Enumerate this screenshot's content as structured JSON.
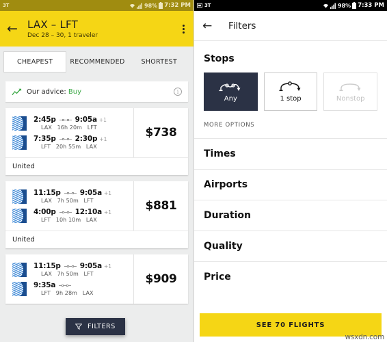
{
  "left": {
    "statusbar": {
      "temp": "3T",
      "wifi": "wifi-icon",
      "signal": "signal-icon",
      "battery_pct": "98%",
      "battery": "battery-icon",
      "time": "7:32 PM"
    },
    "appbar": {
      "back": "←",
      "title": "LAX – LFT",
      "subtitle": "Dec 28 – 30, 1 traveler",
      "menu": "overflow-menu-icon"
    },
    "tabs": [
      {
        "label": "CHEAPEST",
        "active": true
      },
      {
        "label": "RECOMMENDED",
        "active": false
      },
      {
        "label": "SHORTEST",
        "active": false
      }
    ],
    "advice": {
      "icon": "trending-up-icon",
      "text": "Our advice:",
      "value": "Buy",
      "info": "i"
    },
    "cards": [
      {
        "price": "$738",
        "airline": "United",
        "legs": [
          {
            "depart": "2:45p",
            "arrive": "9:05a",
            "plus": "+1",
            "from": "LAX",
            "duration": "16h 20m",
            "to": "LFT",
            "stops": 2
          },
          {
            "depart": "7:35p",
            "arrive": "2:30p",
            "plus": "+1",
            "from": "LFT",
            "duration": "20h 55m",
            "to": "LAX",
            "stops": 2
          }
        ]
      },
      {
        "price": "$881",
        "airline": "United",
        "legs": [
          {
            "depart": "11:15p",
            "arrive": "9:05a",
            "plus": "+1",
            "from": "LAX",
            "duration": "7h 50m",
            "to": "LFT",
            "stops": 2
          },
          {
            "depart": "4:00p",
            "arrive": "12:10a",
            "plus": "+1",
            "from": "LFT",
            "duration": "10h 10m",
            "to": "LAX",
            "stops": 2
          }
        ]
      },
      {
        "price": "$909",
        "airline": "United",
        "legs": [
          {
            "depart": "11:15p",
            "arrive": "9:05a",
            "plus": "+1",
            "from": "LAX",
            "duration": "7h 50m",
            "to": "LFT",
            "stops": 2
          },
          {
            "depart": "9:35a",
            "arrive": "",
            "plus": "",
            "from": "LFT",
            "duration": "9h 28m",
            "to": "LAX",
            "stops": 2
          }
        ]
      }
    ],
    "fab": {
      "icon": "funnel-icon",
      "label": "FILTERS"
    }
  },
  "right": {
    "statusbar": {
      "app_icon": "screenshot-icon",
      "temp": "3T",
      "wifi": "wifi-icon",
      "signal": "signal-icon",
      "battery_pct": "98%",
      "battery": "battery-icon",
      "time": "7:33 PM"
    },
    "appbar": {
      "back": "←",
      "title": "Filters"
    },
    "stops": {
      "title": "Stops",
      "options": [
        {
          "label": "Any",
          "icon": "two-stops-icon",
          "state": "selected"
        },
        {
          "label": "1 stop",
          "icon": "one-stop-icon",
          "state": "normal"
        },
        {
          "label": "Nonstop",
          "icon": "nonstop-icon",
          "state": "disabled"
        }
      ],
      "more_options": "MORE OPTIONS"
    },
    "sections": [
      {
        "label": "Times"
      },
      {
        "label": "Airports"
      },
      {
        "label": "Duration"
      },
      {
        "label": "Quality"
      },
      {
        "label": "Price"
      }
    ],
    "cta": {
      "label": "SEE 70 FLIGHTS"
    },
    "watermark": "wsxdn.com"
  },
  "colors": {
    "brand_yellow": "#f5d615",
    "dark_navy": "#2b3245",
    "advice_green": "#3aa845",
    "united_blue": "#1a4d8f"
  }
}
